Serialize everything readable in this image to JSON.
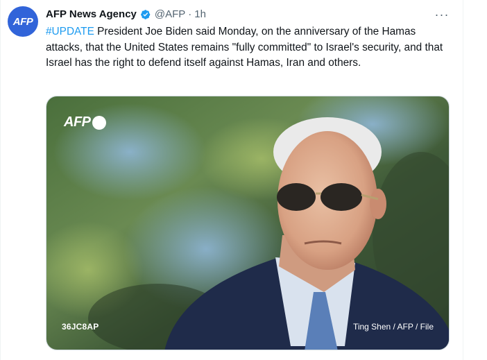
{
  "tweet": {
    "avatar_text": "AFP",
    "display_name": "AFP News Agency",
    "handle": "@AFP",
    "separator": "·",
    "time": "1h",
    "more_label": "···",
    "hashtag": "#UPDATE",
    "body": " President Joe Biden said Monday, on the anniversary of the Hamas attacks, that the United States remains \"fully committed\" to Israel's security, and that Israel has the right to defend itself against Hamas, Iran and others."
  },
  "media": {
    "watermark": "AFP",
    "photo_id": "36JC8AP",
    "credit": "Ting Shen / AFP / File"
  },
  "colors": {
    "link": "#1d9bf0",
    "verified": "#1d9bf0",
    "avatar_bg": "#3164d9",
    "secondary_text": "#536471"
  }
}
